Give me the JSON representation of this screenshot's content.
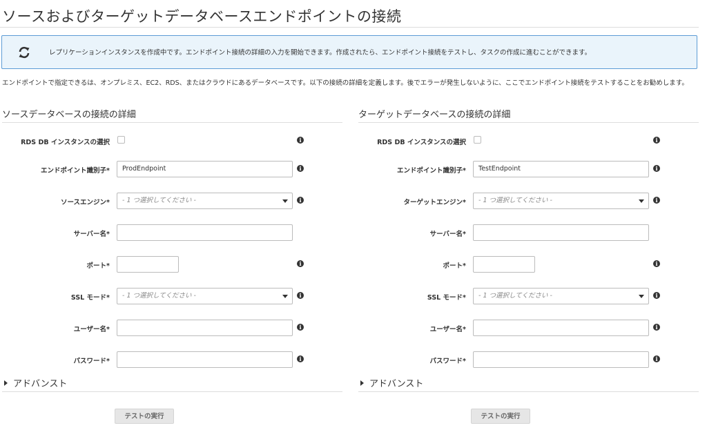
{
  "page": {
    "title": "ソースおよびターゲットデータベースエンドポイントの接続",
    "banner": "レプリケーションインスタンスを作成中です。エンドポイント接続の詳細の入力を開始できます。作成されたら、エンドポイント接続をテストし、タスクの作成に進むことができます。",
    "intro": "エンドポイントで指定できるは、オンプレミス、EC2、RDS、またはクラウドにあるデータベースです。以下の接続の詳細を定義します。後でエラーが発生しないように、ここでエンドポイント接続をテストすることをお勧めします。"
  },
  "source": {
    "section_title": "ソースデータベースの接続の詳細",
    "rds_label": "RDS DB インスタンスの選択",
    "endpoint_id_label": "エンドポイント識別子*",
    "endpoint_id_value": "ProdEndpoint",
    "engine_label": "ソースエンジン*",
    "engine_value": "- 1 つ選択してください -",
    "server_label": "サーバー名*",
    "server_value": "",
    "port_label": "ポート*",
    "port_value": "",
    "ssl_label": "SSL モード*",
    "ssl_value": "- 1 つ選択してください -",
    "user_label": "ユーザー名*",
    "user_value": "",
    "password_label": "パスワード*",
    "password_value": "",
    "advanced": "アドバンスト",
    "test_button": "テストの実行"
  },
  "target": {
    "section_title": "ターゲットデータベースの接続の詳細",
    "rds_label": "RDS DB インスタンスの選択",
    "endpoint_id_label": "エンドポイント識別子*",
    "endpoint_id_value": "TestEndpoint",
    "engine_label": "ターゲットエンジン*",
    "engine_value": "- 1 つ選択してください -",
    "server_label": "サーバー名*",
    "server_value": "",
    "port_label": "ポート*",
    "port_value": "",
    "ssl_label": "SSL モード*",
    "ssl_value": "- 1 つ選択してください -",
    "user_label": "ユーザー名*",
    "user_value": "",
    "password_label": "パスワード*",
    "password_value": "",
    "advanced": "アドバンスト",
    "test_button": "テストの実行"
  },
  "icons": {
    "banner": "refresh-icon",
    "info": "info-icon",
    "dropdown": "chevron-down-icon",
    "expand": "triangle-right-icon"
  }
}
